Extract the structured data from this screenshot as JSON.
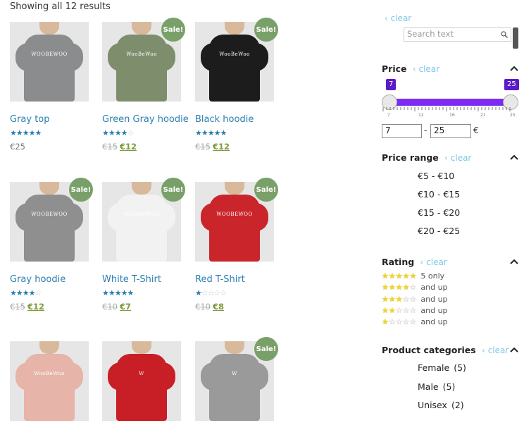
{
  "results_text": "Showing all 12 results",
  "products": [
    {
      "name": "Gray top",
      "rating": 5,
      "old_price": "",
      "price": "€25",
      "sale": false,
      "color": "#8a8c8e",
      "logo": "WOOBEWOO"
    },
    {
      "name": "Green Gray hoodie",
      "rating": 4,
      "old_price": "€15",
      "price": "€12",
      "sale": true,
      "color": "#7e8e6d",
      "logo": "WooBeWoo"
    },
    {
      "name": "Black hoodie",
      "rating": 5,
      "old_price": "€15",
      "price": "€12",
      "sale": true,
      "color": "#1c1c1c",
      "logo": "WooBeWoo"
    },
    {
      "name": "Gray hoodie",
      "rating": 4,
      "old_price": "€15",
      "price": "€12",
      "sale": true,
      "color": "#8f8f8f",
      "logo": "WOOBEWOO"
    },
    {
      "name": "White T-Shirt",
      "rating": 5,
      "old_price": "€10",
      "price": "€7",
      "sale": true,
      "color": "#f2f2f2",
      "logo": "WOOBEWOO"
    },
    {
      "name": "Red T-Shirt",
      "rating": 1,
      "old_price": "€10",
      "price": "€8",
      "sale": true,
      "color": "#c9252b",
      "logo": "WOOBEWOO"
    },
    {
      "name": "",
      "rating": 0,
      "old_price": "",
      "price": "",
      "sale": false,
      "color": "#e6b4a8",
      "logo": "WooBeWoo"
    },
    {
      "name": "",
      "rating": 0,
      "old_price": "",
      "price": "",
      "sale": false,
      "color": "#c81e26",
      "logo": "W"
    },
    {
      "name": "",
      "rating": 0,
      "old_price": "",
      "price": "",
      "sale": true,
      "color": "#9a9a9a",
      "logo": "W"
    }
  ],
  "sale_label": "Sale!",
  "sidebar": {
    "clear_label": "clear",
    "search_placeholder": "Search text",
    "price_title": "Price",
    "price_min": "7",
    "price_max": "25",
    "currency": "€",
    "dash": "-",
    "price_ticks": [
      "7",
      "12",
      "16",
      "21",
      "25"
    ],
    "price_range_title": "Price range",
    "price_ranges": [
      "€5 - €10",
      "€10 - €15",
      "€15 - €20",
      "€20 - €25"
    ],
    "rating_title": "Rating",
    "rating_rows": [
      {
        "stars": 5,
        "label": "5 only"
      },
      {
        "stars": 4,
        "label": "and up"
      },
      {
        "stars": 3,
        "label": "and up"
      },
      {
        "stars": 2,
        "label": "and up"
      },
      {
        "stars": 1,
        "label": "and up"
      }
    ],
    "categories_title": "Product categories",
    "categories": [
      {
        "name": "Female",
        "count": "(5)"
      },
      {
        "name": "Male",
        "count": "(5)"
      },
      {
        "name": "Unisex",
        "count": "(2)"
      }
    ]
  },
  "colors": {
    "link": "#2a7fb0",
    "sale_badge": "#7aa06a",
    "slider": "#7b2cf0",
    "clear": "#7fc8e8"
  }
}
